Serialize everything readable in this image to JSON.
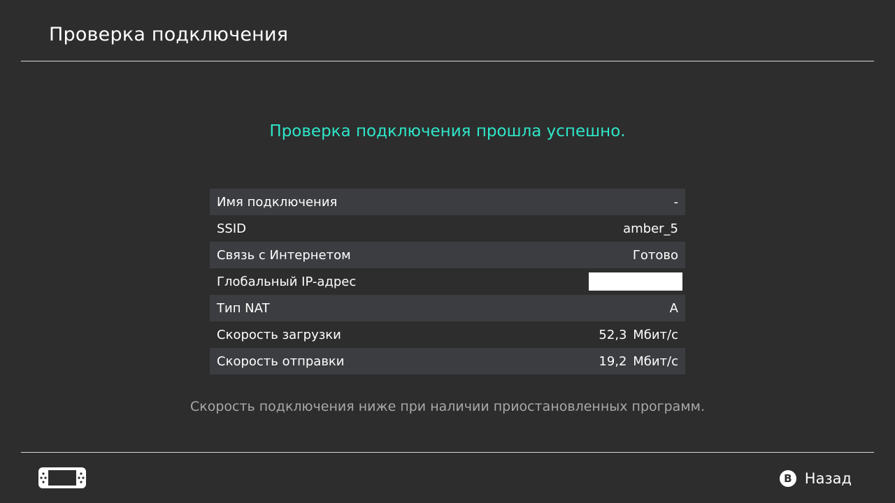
{
  "header": {
    "title": "Проверка подключения"
  },
  "result": {
    "message": "Проверка подключения прошла успешно.",
    "color": "#2ee6c8"
  },
  "details": [
    {
      "label": "Имя подключения",
      "value": "-"
    },
    {
      "label": "SSID",
      "value": "amber_5"
    },
    {
      "label": "Связь с Интернетом",
      "value": "Готово"
    },
    {
      "label": "Глобальный IP-адрес",
      "value": ""
    },
    {
      "label": "Тип NAT",
      "value": "A"
    },
    {
      "label": "Скорость загрузки",
      "value": "52,3  Мбит/с"
    },
    {
      "label": "Скорость отправки",
      "value": "19,2  Мбит/с"
    }
  ],
  "note": "Скорость подключения ниже при наличии приостановленных программ.",
  "footer": {
    "console_icon": "handheld-console-icon",
    "back_button_glyph": "B",
    "back_label": "Назад"
  }
}
